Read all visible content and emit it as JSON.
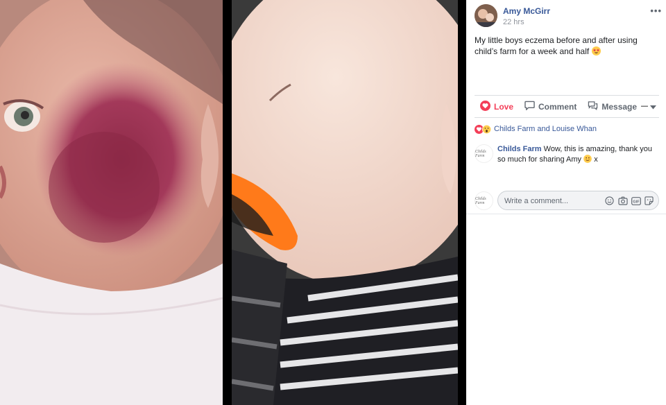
{
  "post": {
    "author": "Amy McGirr",
    "time": "22 hrs",
    "more_label": "•••",
    "caption": "My little boys eczema before and after using child’s farm for a week and half"
  },
  "actions": {
    "love_label": "Love",
    "comment_label": "Comment",
    "message_label": "Message"
  },
  "reactions": {
    "summary": "Childs Farm and Louise Whan"
  },
  "comments": [
    {
      "author": "Childs Farm",
      "text": "Wow, this is amazing, thank you so much for sharing Amy",
      "suffix": "x",
      "avatar_text": "Childs Farm"
    }
  ],
  "composer": {
    "placeholder": "Write a comment...",
    "avatar_text": "Childs Farm"
  },
  "colors": {
    "link": "#385898",
    "love": "#f33e58",
    "viewer_bg": "#000000"
  }
}
